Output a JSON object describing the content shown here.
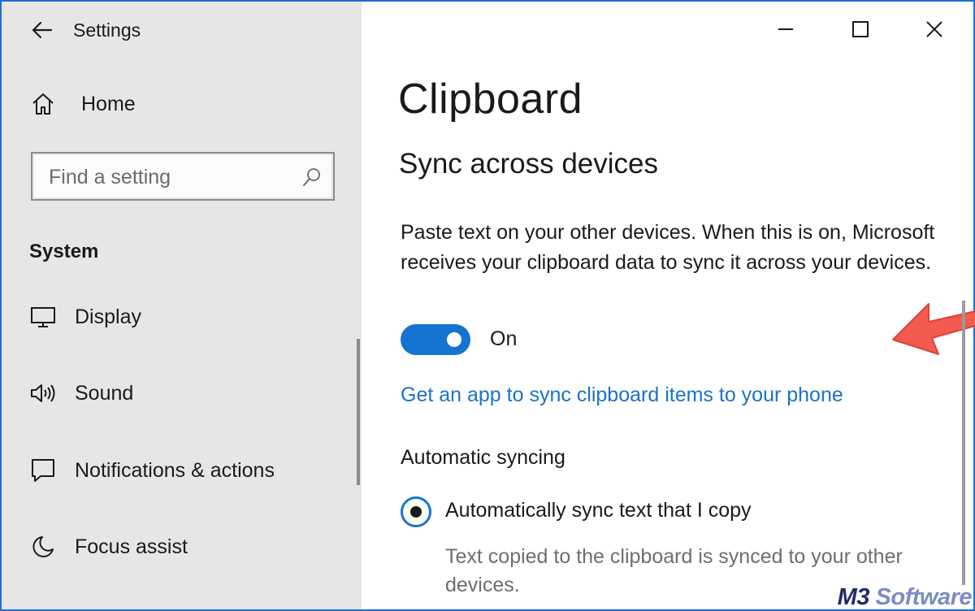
{
  "window": {
    "title": "Settings"
  },
  "sidebar": {
    "home_label": "Home",
    "search_placeholder": "Find a setting",
    "section_label": "System",
    "items": [
      {
        "label": "Display",
        "icon": "monitor-icon"
      },
      {
        "label": "Sound",
        "icon": "speaker-icon"
      },
      {
        "label": "Notifications & actions",
        "icon": "notification-icon"
      },
      {
        "label": "Focus assist",
        "icon": "moon-icon"
      }
    ]
  },
  "main": {
    "title": "Clipboard",
    "sync_heading": "Sync across devices",
    "sync_description": "Paste text on your other devices. When this is on, Microsoft receives your clipboard data to sync it across your devices.",
    "toggle": {
      "state_label": "On",
      "on": true
    },
    "link_text": "Get an app to sync clipboard items to your phone",
    "auto_sync_heading": "Automatic syncing",
    "radio_option": {
      "label": "Automatically sync text that I copy",
      "selected": true,
      "description": "Text copied to the clipboard is synced to your other devices."
    }
  },
  "watermark": {
    "part1": "M3",
    "part2": " Software"
  },
  "colors": {
    "accent": "#1574d1",
    "link": "#1a73c9",
    "sidebar_bg": "#e6e6e6",
    "annotation_arrow": "#f25a4e"
  }
}
